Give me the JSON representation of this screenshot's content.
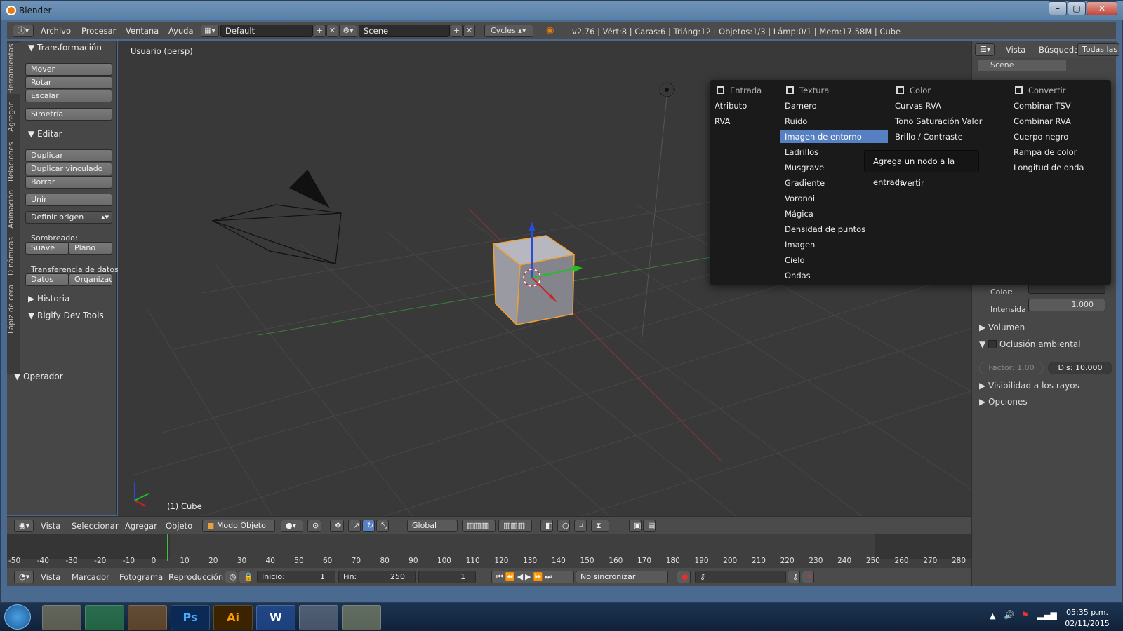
{
  "window": {
    "title": "Blender"
  },
  "infobar": {
    "menus": [
      "Archivo",
      "Procesar",
      "Ventana",
      "Ayuda"
    ],
    "layout": "Default",
    "scene": "Scene",
    "engine": "Cycles",
    "stats": "v2.76 | Vért:8 | Caras:6 | Triáng:12 | Objetos:1/3 | Lámp:0/1 | Mem:17.58M | Cube"
  },
  "toolshelf": {
    "vertical_tabs": [
      "Herramientas",
      "Agregar",
      "Relaciones",
      "Animación",
      "Dinámicas",
      "Lápiz de cera"
    ],
    "transform_header": "Transformación",
    "transform_buttons": [
      "Mover",
      "Rotar",
      "Escalar"
    ],
    "mirror": "Simetría",
    "edit_header": "Editar",
    "edit_buttons": [
      "Duplicar",
      "Duplicar vinculado",
      "Borrar"
    ],
    "join": "Unir",
    "set_origin": "Definir origen",
    "shading_label": "Sombreado:",
    "smooth": "Suave",
    "flat": "Plano",
    "data_transfer_label": "Transferencia de datos:",
    "data": "Datos",
    "organize": "Organizaci",
    "history": "Historia",
    "rigify": "Rigify Dev Tools",
    "operator": "Operador"
  },
  "viewport": {
    "view_label": "Usuario (persp)",
    "object_label": "(1) Cube"
  },
  "viewport_header": {
    "menus": [
      "Vista",
      "Seleccionar",
      "Agregar",
      "Objeto"
    ],
    "mode": "Modo Objeto",
    "orientation": "Global"
  },
  "timeline": {
    "ruler": [
      "-50",
      "-40",
      "-30",
      "-20",
      "-10",
      "0",
      "10",
      "20",
      "30",
      "40",
      "50",
      "60",
      "70",
      "80",
      "90",
      "100",
      "110",
      "120",
      "130",
      "140",
      "150",
      "160",
      "170",
      "180",
      "190",
      "200",
      "210",
      "220",
      "230",
      "240",
      "250",
      "260",
      "270",
      "280"
    ],
    "current_frame_fraction": 0.147,
    "menus": [
      "Vista",
      "Marcador",
      "Fotograma",
      "Reproducción"
    ],
    "start_label": "Inicio:",
    "start_value": "1",
    "end_label": "Fin:",
    "end_value": "250",
    "current": "1",
    "sync": "No sincronizar"
  },
  "rightpanel": {
    "tabs": [
      "Vista",
      "Búsqueda",
      "Todas las"
    ],
    "scene_item": "Scene",
    "color_label": "Color:",
    "intensity_label": "Intensida",
    "intensity_value": "1.000",
    "volume": "Volumen",
    "ao": "Oclusión ambiental",
    "factor": "Factor: 1.00",
    "dist": "Dis: 10.000",
    "ray_visibility": "Visibilidad a los rayos",
    "options": "Opciones"
  },
  "addmenu": {
    "columns": [
      {
        "header": "Entrada",
        "items": [
          "Atributo",
          "RVA"
        ]
      },
      {
        "header": "Textura",
        "items": [
          "Damero",
          "Ruido",
          "Imagen de entorno",
          "Ladrillos",
          "Musgrave",
          "Gradiente",
          "Voronoi",
          "Mágica",
          "Densidad de puntos",
          "Imagen",
          "Cielo",
          "Ondas"
        ]
      },
      {
        "header": "Color",
        "items": [
          "Curvas RVA",
          "Tono Saturación Valor",
          "Brillo / Contraste",
          "",
          "",
          "Invertir"
        ]
      },
      {
        "header": "Convertir",
        "items": [
          "Combinar TSV",
          "Combinar RVA",
          "Cuerpo negro",
          "Rampa de color",
          "Longitud de onda"
        ]
      }
    ],
    "selected": "Imagen de entorno",
    "tooltip": "Agrega un nodo a la entrada"
  },
  "taskbar": {
    "time": "05:35 p.m.",
    "date": "02/11/2015"
  }
}
